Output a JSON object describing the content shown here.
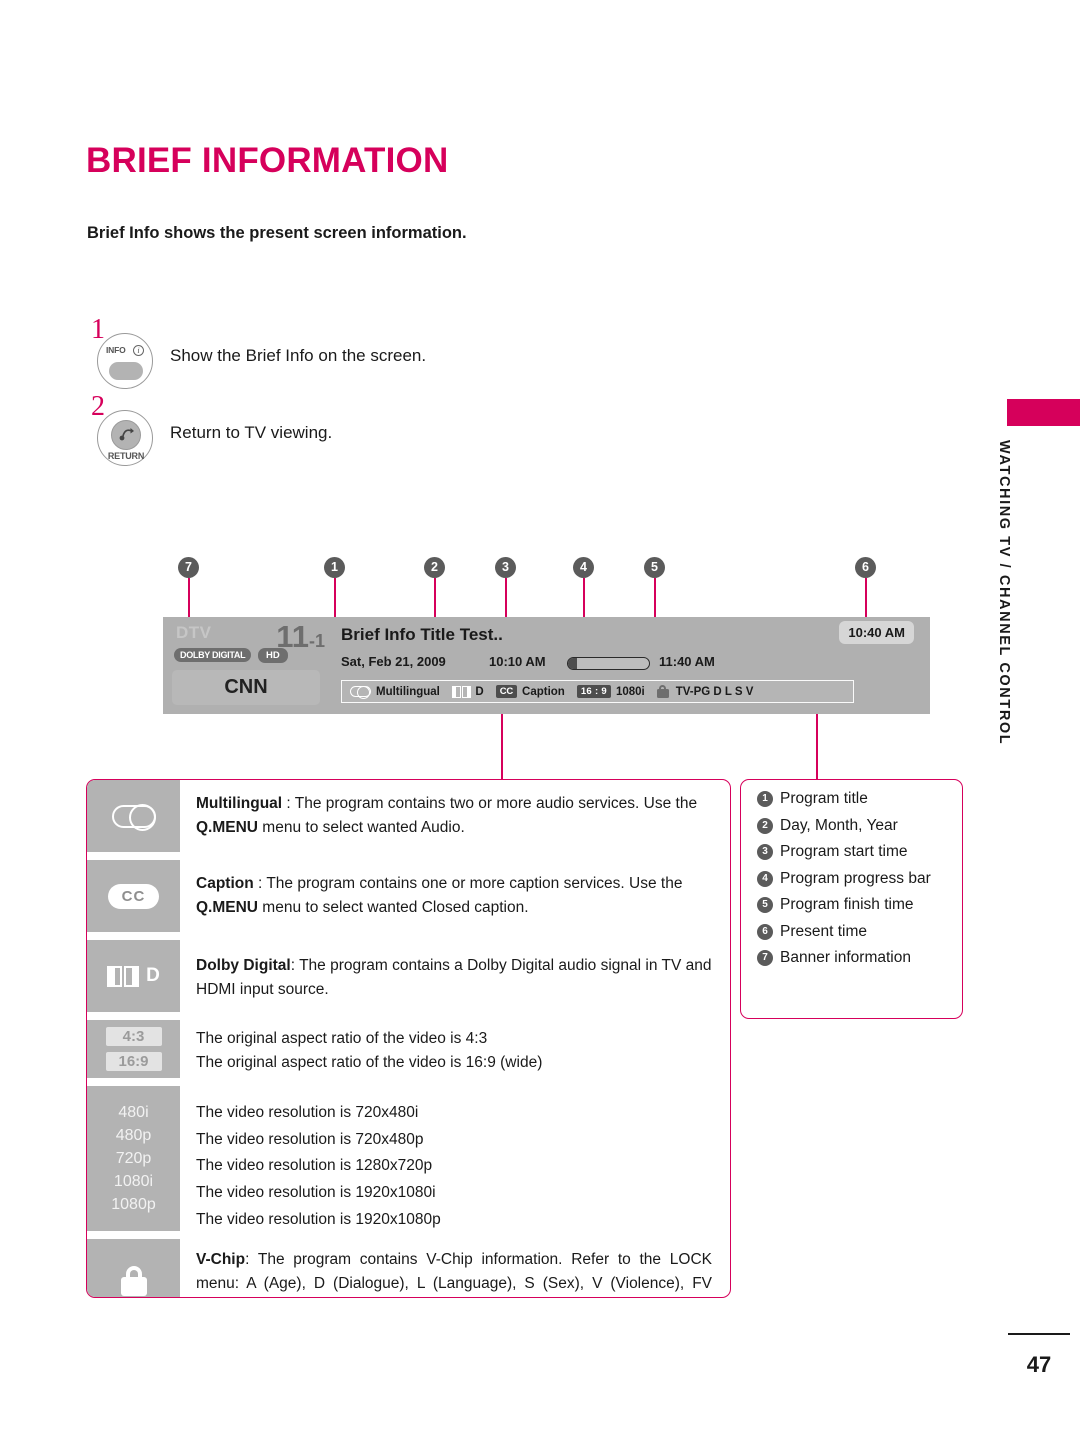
{
  "page": {
    "title": "BRIEF INFORMATION",
    "subtitle": "Brief Info shows the present screen information.",
    "side_tab": "WATCHING TV / CHANNEL CONTROL",
    "page_number": "47",
    "accent_color": "#d6005b"
  },
  "steps": [
    {
      "num": "1",
      "button_label": "INFO",
      "button_icon": "info-circle-icon",
      "text": "Show the Brief Info on the screen."
    },
    {
      "num": "2",
      "button_label": "RETURN",
      "button_icon": "return-arrow-icon",
      "text": "Return to TV viewing."
    }
  ],
  "callouts": [
    {
      "num": "7"
    },
    {
      "num": "1"
    },
    {
      "num": "2"
    },
    {
      "num": "3"
    },
    {
      "num": "4"
    },
    {
      "num": "5"
    },
    {
      "num": "6"
    }
  ],
  "osd": {
    "source": "DTV",
    "channel_number": "11",
    "channel_sub": "-1",
    "badge_dolby": "DOLBY DIGITAL",
    "badge_hd": "HD",
    "channel_name": "CNN",
    "program_title": "Brief Info Title Test..",
    "date": "Sat, Feb 21, 2009",
    "start_time": "10:10 AM",
    "end_time": "11:40 AM",
    "progress_percent": 11,
    "present_time": "10:40 AM",
    "info_strip": [
      {
        "icon": "multilingual-icon",
        "label": "Multilingual"
      },
      {
        "icon": "dolby-digital-icon",
        "label": "D"
      },
      {
        "icon": "closed-caption-icon",
        "label": "Caption"
      },
      {
        "icon": "aspect-16-9-icon",
        "label": "1080i"
      },
      {
        "icon": "lock-icon",
        "label": "TV-PG  D L S V"
      }
    ]
  },
  "legend": [
    {
      "icon": "multilingual-icon",
      "text_parts": [
        {
          "t": "Multilingual",
          "b": true
        },
        {
          "t": " : The program contains two or more audio services. Use the ",
          "b": false
        },
        {
          "t": "Q.MENU",
          "b": true
        },
        {
          "t": " menu to select wanted Audio.",
          "b": false
        }
      ]
    },
    {
      "icon": "closed-caption-icon",
      "text_parts": [
        {
          "t": "Caption",
          "b": true
        },
        {
          "t": " : The program contains one or more caption services. Use the ",
          "b": false
        },
        {
          "t": "Q.MENU",
          "b": true
        },
        {
          "t": " menu to select wanted Closed caption.",
          "b": false
        }
      ]
    },
    {
      "icon": "dolby-digital-icon",
      "text_parts": [
        {
          "t": "Dolby Digital",
          "b": true
        },
        {
          "t": ": The program contains a Dolby Digital audio signal in TV and HDMI input source.",
          "b": false
        }
      ]
    }
  ],
  "aspect_rows": [
    {
      "chip": "4:3",
      "text": "The original aspect ratio of the video is 4:3"
    },
    {
      "chip": "16:9",
      "text": "The original aspect ratio of the video is 16:9 (wide)"
    }
  ],
  "resolution_rows": [
    {
      "chip": "480i",
      "text": "The video resolution is 720x480i"
    },
    {
      "chip": "480p",
      "text": "The video resolution is 720x480p"
    },
    {
      "chip": "720p",
      "text": "The video resolution is 1280x720p"
    },
    {
      "chip": "1080i",
      "text": "The video resolution is 1920x1080i"
    },
    {
      "chip": "1080p",
      "text": "The video resolution is 1920x1080p"
    }
  ],
  "vchip": {
    "icon": "lock-icon",
    "text_parts": [
      {
        "t": "V-Chip",
        "b": true
      },
      {
        "t": ": The program contains V-Chip information. Refer to the LOCK menu: A (Age), D (Dialogue), L (Language), S (Sex), V (Violence), FV (Fantasy Violence)",
        "b": false
      }
    ]
  },
  "number_list": [
    {
      "num": "1",
      "label": "Program title"
    },
    {
      "num": "2",
      "label": "Day, Month, Year"
    },
    {
      "num": "3",
      "label": "Program start time"
    },
    {
      "num": "4",
      "label": "Program progress bar"
    },
    {
      "num": "5",
      "label": "Program finish time"
    },
    {
      "num": "6",
      "label": "Present time"
    },
    {
      "num": "7",
      "label": "Banner information"
    }
  ]
}
